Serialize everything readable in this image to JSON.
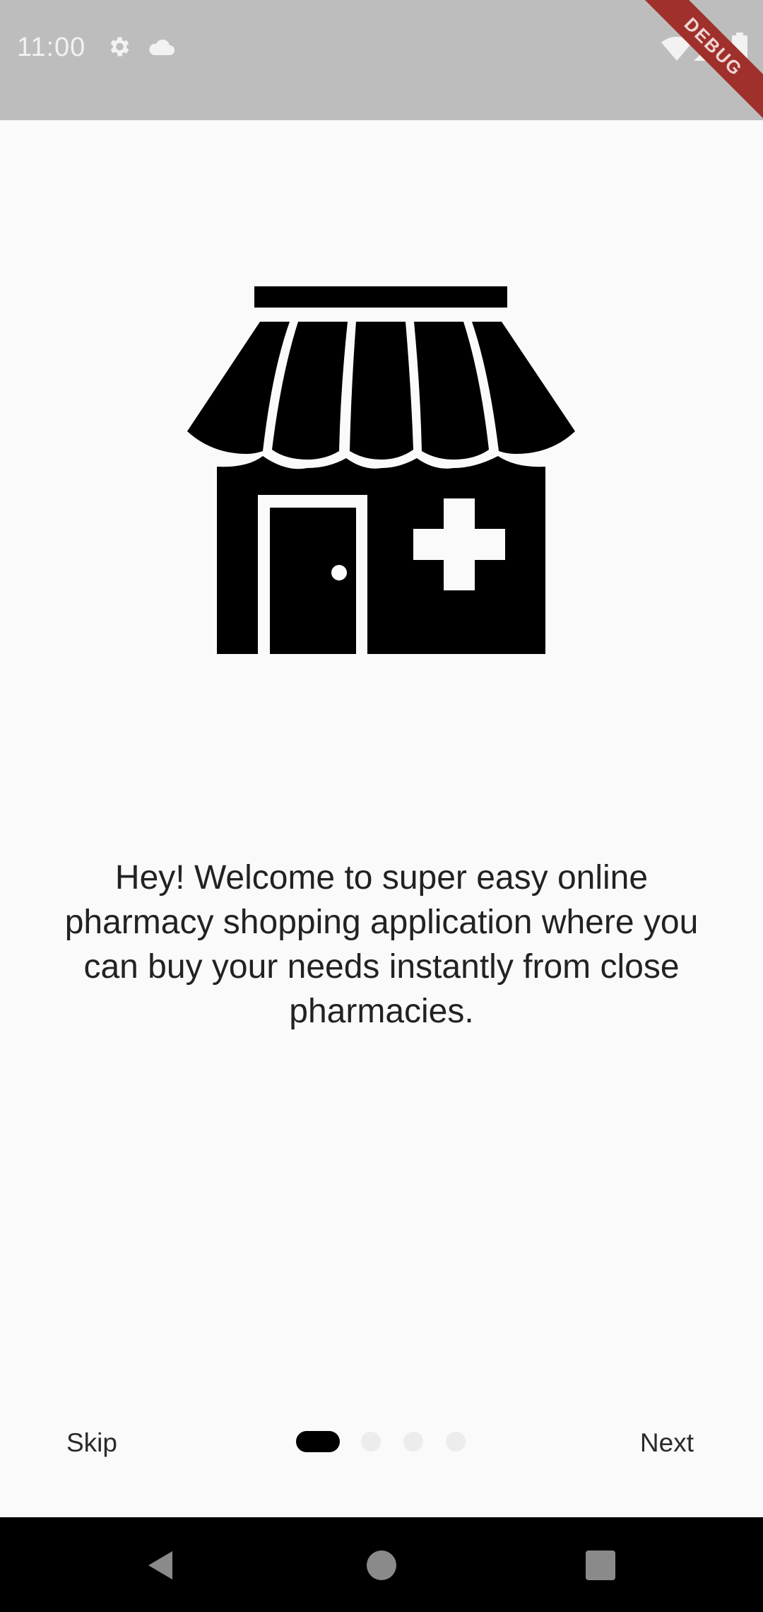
{
  "status_bar": {
    "time": "11:00",
    "debug_label": "DEBUG",
    "icons": [
      "settings-icon",
      "cloud-icon",
      "wifi-icon",
      "signal-icon",
      "battery-icon"
    ]
  },
  "onboarding": {
    "illustration_icon": "pharmacy-store-icon",
    "message": "Hey! Welcome to super easy online pharmacy shopping application where you can buy your needs instantly from close pharmacies.",
    "skip_label": "Skip",
    "next_label": "Next",
    "page_count": 4,
    "current_page": 1
  },
  "nav_bar": {
    "icons": [
      "back-icon",
      "home-icon",
      "recents-icon"
    ]
  },
  "colors": {
    "status_bar": "#bdbdbd",
    "background": "#fafafa",
    "active_dot": "#000000",
    "inactive_dot": "#ececec",
    "debug_banner": "#a0302c"
  }
}
